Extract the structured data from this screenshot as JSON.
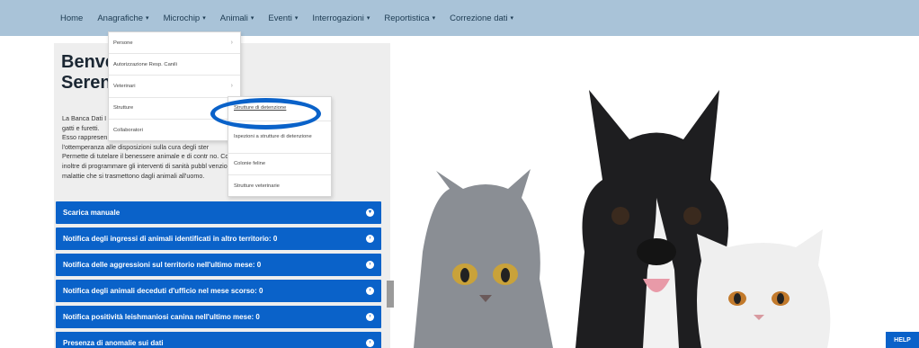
{
  "navbar": {
    "items": [
      {
        "label": "Home",
        "caret": false
      },
      {
        "label": "Anagrafiche",
        "caret": true
      },
      {
        "label": "Microchip",
        "caret": true
      },
      {
        "label": "Animali",
        "caret": true
      },
      {
        "label": "Eventi",
        "caret": true
      },
      {
        "label": "Interrogazioni",
        "caret": true
      },
      {
        "label": "Reportistica",
        "caret": true
      },
      {
        "label": "Correzione dati",
        "caret": true
      }
    ],
    "caret_glyph": "▾"
  },
  "welcome": {
    "line1": "Benve",
    "line2": "Serena"
  },
  "intro": {
    "lines": [
      "La Banca Dati I                                                                                                   one di cani,",
      "gatti e furetti.",
      "Esso rappresen                                                                                                 e",
      "l'ottemperanza alle disposizioni sulla cura degli ster",
      "Permette di tutelare il benessere animale e di contr                                                          no. Consente",
      "inoltre di programmare gli interventi di sanità pubbl                                                         venzione delle",
      "malattie che si trasmettono dagli animali all'uomo."
    ]
  },
  "dropdown": {
    "items": [
      {
        "label": "Persone",
        "arrow": true
      },
      {
        "label": "Autorizzazione Resp. Canili",
        "arrow": false
      },
      {
        "label": "Veterinari",
        "arrow": true
      },
      {
        "label": "Strutture",
        "arrow": true
      },
      {
        "label": "Collaboratori",
        "arrow": false
      }
    ],
    "arrow_glyph": "›"
  },
  "submenu": {
    "items": [
      {
        "label": "Strutture di detenzione",
        "underlined": true
      },
      {
        "label": "Ispezioni a strutture di detenzione",
        "underlined": false
      },
      {
        "label": "Colonie feline",
        "underlined": false
      },
      {
        "label": "Strutture veterinarie",
        "underlined": false
      }
    ]
  },
  "accordion": {
    "items": [
      {
        "label": "Scarica manuale",
        "chevron": "▾"
      },
      {
        "label": "Notifica degli ingressi di animali identificati in altro territorio: 0",
        "chevron": "›"
      },
      {
        "label": "Notifica delle aggressioni sul territorio nell'ultimo mese: 0",
        "chevron": "›"
      },
      {
        "label": "Notifica degli animali deceduti d'ufficio nel mese scorso: 0",
        "chevron": "›"
      },
      {
        "label": "Notifica positività leishmaniosi canina nell'ultimo mese: 0",
        "chevron": "›"
      },
      {
        "label": "Presenza di anomalie sui dati",
        "chevron": "›"
      }
    ]
  },
  "help": {
    "label": "HELP"
  },
  "colors": {
    "navbar": "#a9c3d8",
    "accent": "#0a62c9",
    "card": "#eeeeee"
  }
}
